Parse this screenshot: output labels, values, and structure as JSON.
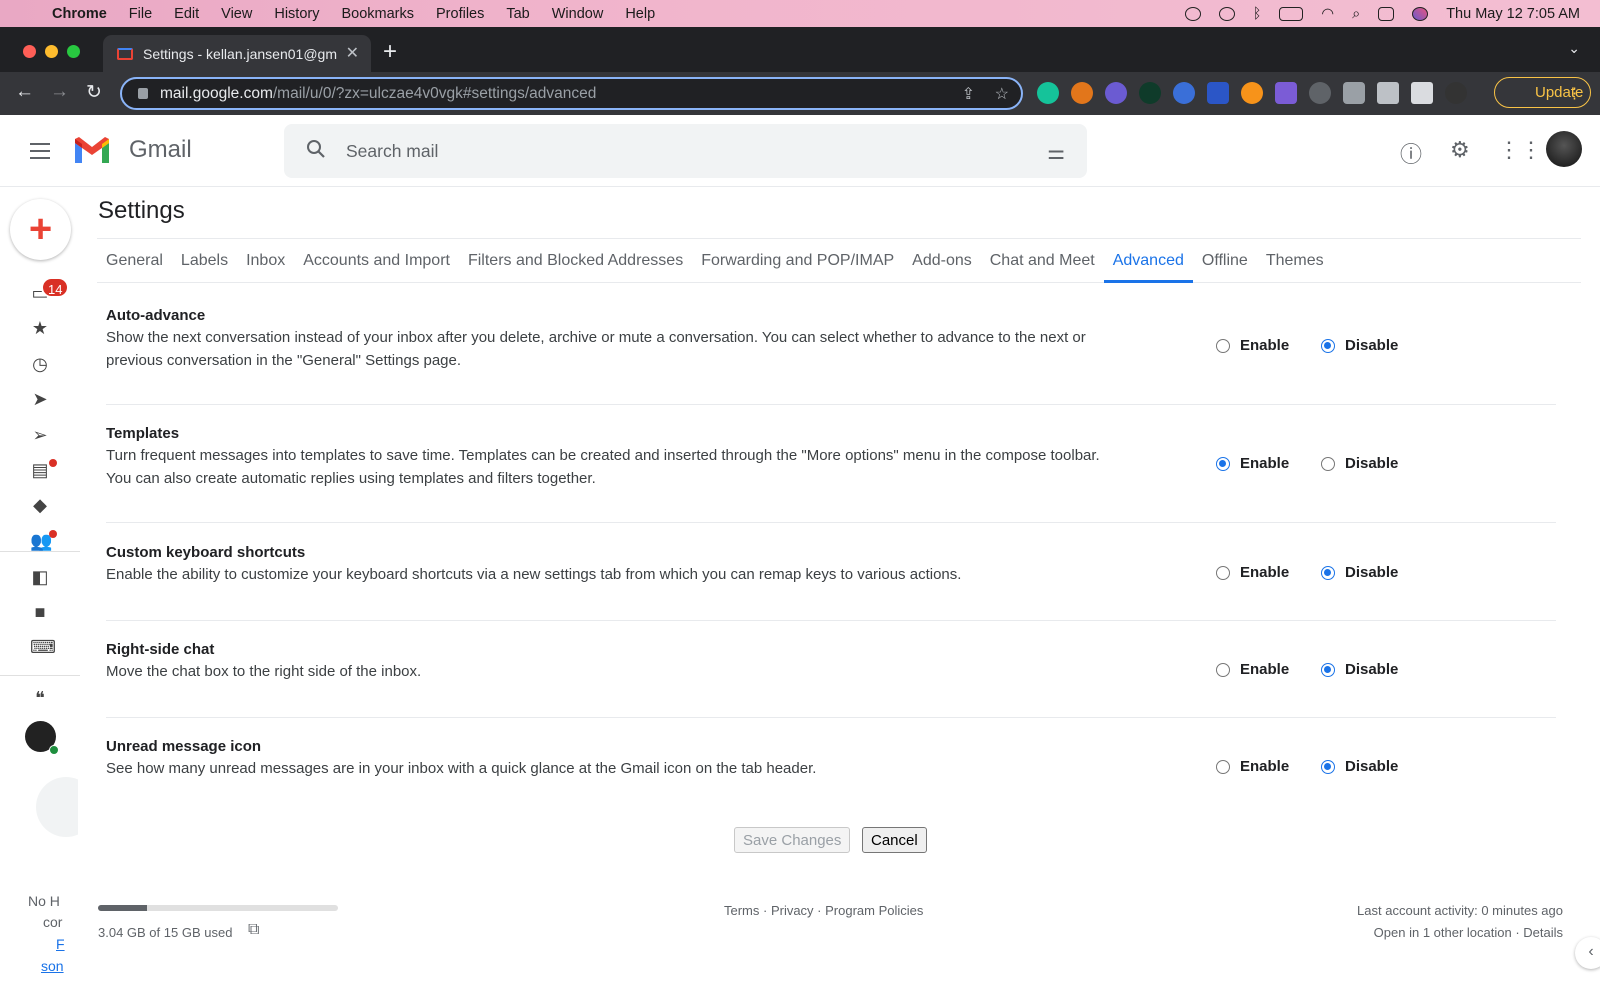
{
  "macos": {
    "app_name": "Chrome",
    "menu": [
      "File",
      "Edit",
      "View",
      "History",
      "Bookmarks",
      "Profiles",
      "Tab",
      "Window",
      "Help"
    ],
    "datetime": "Thu May 12  7:05 AM"
  },
  "browser": {
    "tab_title": "Settings - kellan.jansen01@gm",
    "url_host": "mail.google.com",
    "url_path": "/mail/u/0/?zx=ulczae4v0vgk#settings/advanced",
    "update_label": "Update"
  },
  "gmail": {
    "product_name": "Gmail",
    "search_placeholder": "Search mail",
    "inbox_badge": "14"
  },
  "settings": {
    "title": "Settings",
    "tabs": [
      "General",
      "Labels",
      "Inbox",
      "Accounts and Import",
      "Filters and Blocked Addresses",
      "Forwarding and POP/IMAP",
      "Add-ons",
      "Chat and Meet",
      "Advanced",
      "Offline",
      "Themes"
    ],
    "active_tab": "Advanced",
    "enable_label": "Enable",
    "disable_label": "Disable",
    "rows": [
      {
        "name": "Auto-advance",
        "desc": "Show the next conversation instead of your inbox after you delete, archive or mute a conversation. You can select whether to advance to the next or previous conversation in the \"General\" Settings page.",
        "selected": "Disable"
      },
      {
        "name": "Templates",
        "desc": "Turn frequent messages into templates to save time. Templates can be created and inserted through the \"More options\" menu in the compose toolbar. You can also create automatic replies using templates and filters together.",
        "selected": "Enable"
      },
      {
        "name": "Custom keyboard shortcuts",
        "desc": "Enable the ability to customize your keyboard shortcuts via a new settings tab from which you can remap keys to various actions.",
        "selected": "Disable"
      },
      {
        "name": "Right-side chat",
        "desc": "Move the chat box to the right side of the inbox.",
        "selected": "Disable"
      },
      {
        "name": "Unread message icon",
        "desc": "See how many unread messages are in your inbox with a quick glance at the Gmail icon on the tab header.",
        "selected": "Disable"
      }
    ],
    "save_label": "Save Changes",
    "cancel_label": "Cancel"
  },
  "footer": {
    "storage_text": "3.04 GB of 15 GB used",
    "storage_fraction": 0.2027,
    "links": "Terms · Privacy · Program Policies",
    "activity": "Last account activity: 0 minutes ago",
    "open_locations": "Open in 1 other location · Details"
  },
  "rail_cut": {
    "line1": "No H",
    "line2": "cor",
    "line3": "F",
    "line4": "son"
  },
  "colors": {
    "accent": "#1a73e8",
    "badge": "#d93025",
    "update": "#f9c346"
  }
}
